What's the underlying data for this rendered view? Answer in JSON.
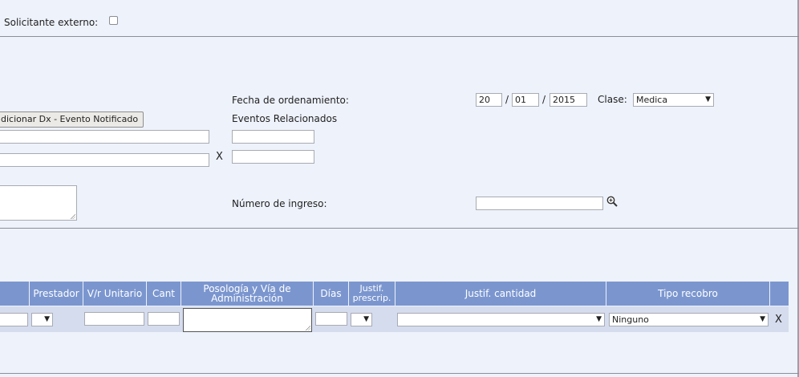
{
  "top": {
    "external_requester_label": "Solicitante externo:",
    "external_requester_checked": false
  },
  "form": {
    "add_dx_button": "dicionar Dx - Evento Notificado",
    "x_label": "X",
    "order_date_label": "Fecha de ordenamiento:",
    "order_date_day": "20",
    "order_date_month": "01",
    "order_date_year": "2015",
    "date_sep": "/",
    "class_label": "Clase:",
    "class_value": "Medica",
    "related_events_label": "Eventos Relacionados",
    "admission_number_label": "Número de ingreso:",
    "admission_number_value": ""
  },
  "table": {
    "headers": {
      "provider": "Prestador",
      "unit_value": "V/r Unitario",
      "qty": "Cant",
      "posology": "Posología y Vía de Administración",
      "days": "Días",
      "justif_prescrip": "Justif. prescrip.",
      "justif_qty": "Justif. cantidad",
      "recobro_type": "Tipo recobro"
    },
    "row": {
      "recobro_value": "Ninguno",
      "remove_label": "X"
    }
  },
  "colors": {
    "header_bg": "#7b96cf",
    "row_bg": "#d5dcee",
    "page_bg": "#eef2fb"
  }
}
